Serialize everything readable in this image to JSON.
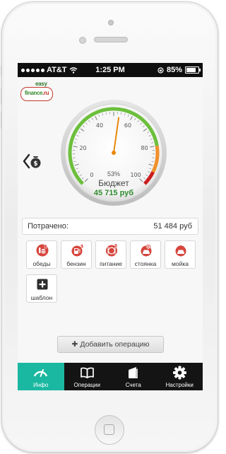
{
  "status_bar": {
    "carrier": "AT&T",
    "time": "1:25 PM",
    "battery": "85%"
  },
  "logo": {
    "top_text": "easy",
    "main_text": "finance",
    "suffix": ".ru"
  },
  "gauge": {
    "ticks": [
      "0",
      "20",
      "40",
      "60",
      "80",
      "100"
    ],
    "percent_label": "53%",
    "needle_percent": 53,
    "title": "Бюджет",
    "amount": "45 715 руб",
    "colors": {
      "green": "#6cbf3c",
      "orange": "#f0902a",
      "red": "#cc1e1e",
      "needle": "#e8880a"
    }
  },
  "spent": {
    "label": "Потрачено:",
    "value": "51 484 руб"
  },
  "categories": [
    {
      "label": "обеды",
      "icon": "burger-icon"
    },
    {
      "label": "бензин",
      "icon": "fuel-pump-icon"
    },
    {
      "label": "питание",
      "icon": "cutlery-icon"
    },
    {
      "label": "стоянка",
      "icon": "parking-icon"
    },
    {
      "label": "мойка",
      "icon": "car-wash-icon"
    },
    {
      "label": "шаблон",
      "icon": "plus-square-icon"
    }
  ],
  "add_button": {
    "label": "Добавить операцию"
  },
  "tabs": [
    {
      "label": "Инфо",
      "icon": "speedometer-icon",
      "active": true
    },
    {
      "label": "Операции",
      "icon": "book-icon",
      "active": false
    },
    {
      "label": "Счета",
      "icon": "wallet-icon",
      "active": false
    },
    {
      "label": "Настройки",
      "icon": "gear-icon",
      "active": false
    }
  ]
}
